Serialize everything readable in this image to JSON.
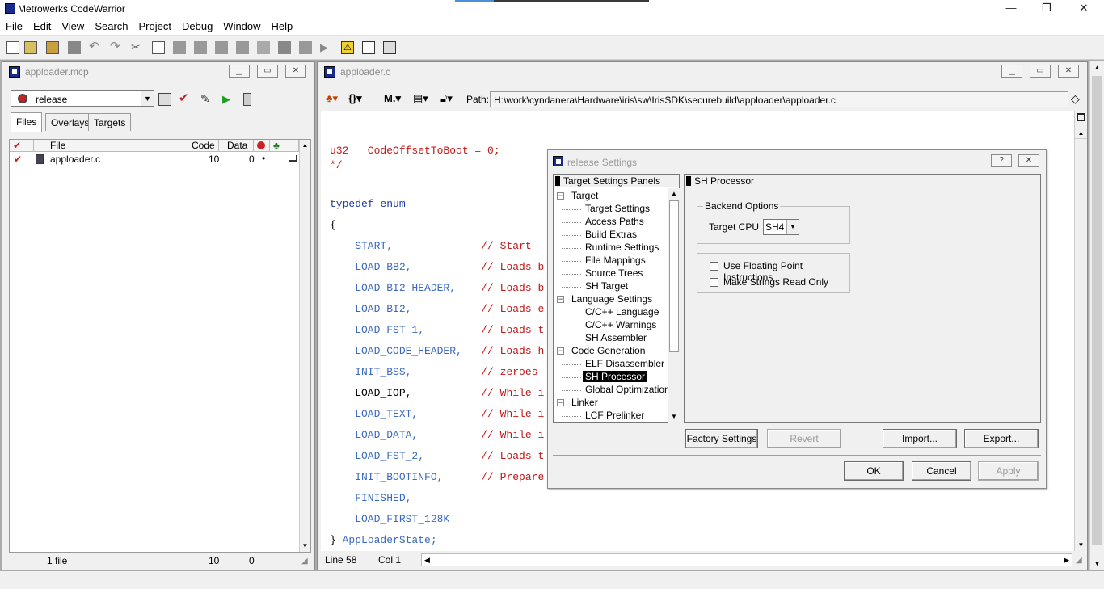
{
  "app": {
    "title": "Metrowerks CodeWarrior",
    "window_controls": [
      "—",
      "❐",
      "✕"
    ]
  },
  "menu": [
    "File",
    "Edit",
    "View",
    "Search",
    "Project",
    "Debug",
    "Window",
    "Help"
  ],
  "project_window": {
    "title": "apploader.mcp",
    "target": "release",
    "tabs": [
      "Files",
      "Overlays",
      "Targets"
    ],
    "columns": {
      "file": "File",
      "code": "Code",
      "data": "Data"
    },
    "files": [
      {
        "name": "apploader.c",
        "code": "10",
        "data": "0",
        "marker": "•"
      }
    ],
    "status": {
      "count": "1 file",
      "code": "10",
      "data": "0"
    }
  },
  "editor_window": {
    "title": "apploader.c",
    "path_label": "Path:",
    "path": "H:\\work\\cyndanera\\Hardware\\iris\\sw\\IrisSDK\\securebuild\\apploader\\apploader.c",
    "code_lines": [
      {
        "a": "u32",
        "b": "   CodeOffsetToBoot = 0;",
        "kind": "decl"
      },
      {
        "a": "*/",
        "kind": "comment-close"
      },
      {
        "a": "typedef",
        "b": " enum",
        "kind": "typedef"
      },
      {
        "a": "{",
        "kind": "plain"
      },
      {
        "a": "    START,",
        "b": "              // Start",
        "kind": "enum"
      },
      {
        "a": "    LOAD_BB2,",
        "b": "           // Loads b",
        "kind": "enum"
      },
      {
        "a": "    LOAD_BI2_HEADER,",
        "b": "    // Loads b",
        "kind": "enum"
      },
      {
        "a": "    LOAD_BI2,",
        "b": "           // Loads e",
        "kind": "enum"
      },
      {
        "a": "    LOAD_FST_1,",
        "b": "         // Loads t",
        "kind": "enum"
      },
      {
        "a": "    LOAD_CODE_HEADER,",
        "b": "   // Loads h",
        "kind": "enum"
      },
      {
        "a": "    INIT_BSS,",
        "b": "           // zeroes",
        "kind": "enum"
      },
      {
        "a": "    LOAD_IOP,",
        "b": "           // While i",
        "kind": "enum-dark"
      },
      {
        "a": "    LOAD_TEXT,",
        "b": "          // While i",
        "kind": "enum"
      },
      {
        "a": "    LOAD_DATA,",
        "b": "          // While i",
        "kind": "enum"
      },
      {
        "a": "    LOAD_FST_2,",
        "b": "         // Loads t",
        "kind": "enum"
      },
      {
        "a": "    INIT_BOOTINFO,",
        "b": "      // Prepare",
        "kind": "enum"
      },
      {
        "a": "    FINISHED,",
        "kind": "enum"
      },
      {
        "a": "    LOAD_FIRST_128K",
        "kind": "enum"
      },
      {
        "a": "} ",
        "b": "AppLoaderState;",
        "kind": "close"
      }
    ],
    "status": {
      "line": "Line 58",
      "col": "Col 1"
    }
  },
  "settings_dialog": {
    "title": "release Settings",
    "help_label": "?",
    "close_label": "✕",
    "panels_header": "Target Settings Panels",
    "tree": [
      {
        "label": "Target",
        "level": 0,
        "expander": "−"
      },
      {
        "label": "Target Settings",
        "level": 1
      },
      {
        "label": "Access Paths",
        "level": 1
      },
      {
        "label": "Build Extras",
        "level": 1
      },
      {
        "label": "Runtime Settings",
        "level": 1
      },
      {
        "label": "File Mappings",
        "level": 1
      },
      {
        "label": "Source Trees",
        "level": 1
      },
      {
        "label": "SH Target",
        "level": 1
      },
      {
        "label": "Language Settings",
        "level": 0,
        "expander": "−"
      },
      {
        "label": "C/C++ Language",
        "level": 1
      },
      {
        "label": "C/C++ Warnings",
        "level": 1
      },
      {
        "label": "SH Assembler",
        "level": 1
      },
      {
        "label": "Code Generation",
        "level": 0,
        "expander": "−"
      },
      {
        "label": "ELF Disassembler",
        "level": 1
      },
      {
        "label": "SH Processor",
        "level": 1,
        "selected": true
      },
      {
        "label": "Global Optimizations",
        "level": 1
      },
      {
        "label": "Linker",
        "level": 0,
        "expander": "−"
      },
      {
        "label": "LCF Prelinker",
        "level": 1
      }
    ],
    "panel_title": "SH Processor",
    "backend_group": "Backend Options",
    "target_cpu_label": "Target CPU",
    "target_cpu_value": "SH4",
    "checkboxes": [
      {
        "label": "Use Floating Point Instructions",
        "checked": false
      },
      {
        "label": "Make Strings Read Only",
        "checked": false
      }
    ],
    "buttons": {
      "factory": "Factory Settings",
      "revert": "Revert",
      "import": "Import...",
      "export": "Export...",
      "ok": "OK",
      "cancel": "Cancel",
      "apply": "Apply"
    }
  },
  "colors": {
    "keyword": "#1a3ba0",
    "identifier": "#3a6ac0",
    "comment": "#c01818",
    "selection": "#000000"
  }
}
